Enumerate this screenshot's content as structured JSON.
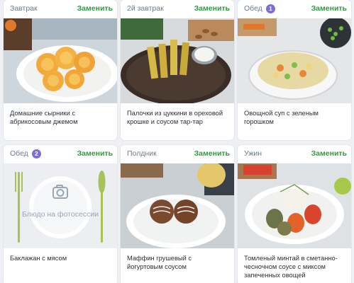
{
  "common": {
    "replace_label": "Заменить"
  },
  "colors": {
    "accent_green": "#2e9a3e",
    "badge_purple": "#7b6fd6",
    "meal_label": "#6b7a8c"
  },
  "cards": [
    {
      "meal": "Завтрак",
      "badge": "",
      "name": "Домашние сырники с абрикосовым джемом"
    },
    {
      "meal": "2й завтрак",
      "badge": "",
      "name": "Палочки из цуккини в ореховой крошке и соусом тар-тар"
    },
    {
      "meal": "Обед",
      "badge": "1",
      "name": "Овощной суп с зеленым горошком"
    },
    {
      "meal": "Обед",
      "badge": "2",
      "name": "Баклажан с мясом",
      "placeholder": "Блюдо на фотосессии"
    },
    {
      "meal": "Полдник",
      "badge": "",
      "name": "Маффин грушевый с йогуртовым соусом"
    },
    {
      "meal": "Ужин",
      "badge": "",
      "name": "Томленый минтай в сметанно-чесночном соусе с миксом запеченных овощей"
    }
  ]
}
